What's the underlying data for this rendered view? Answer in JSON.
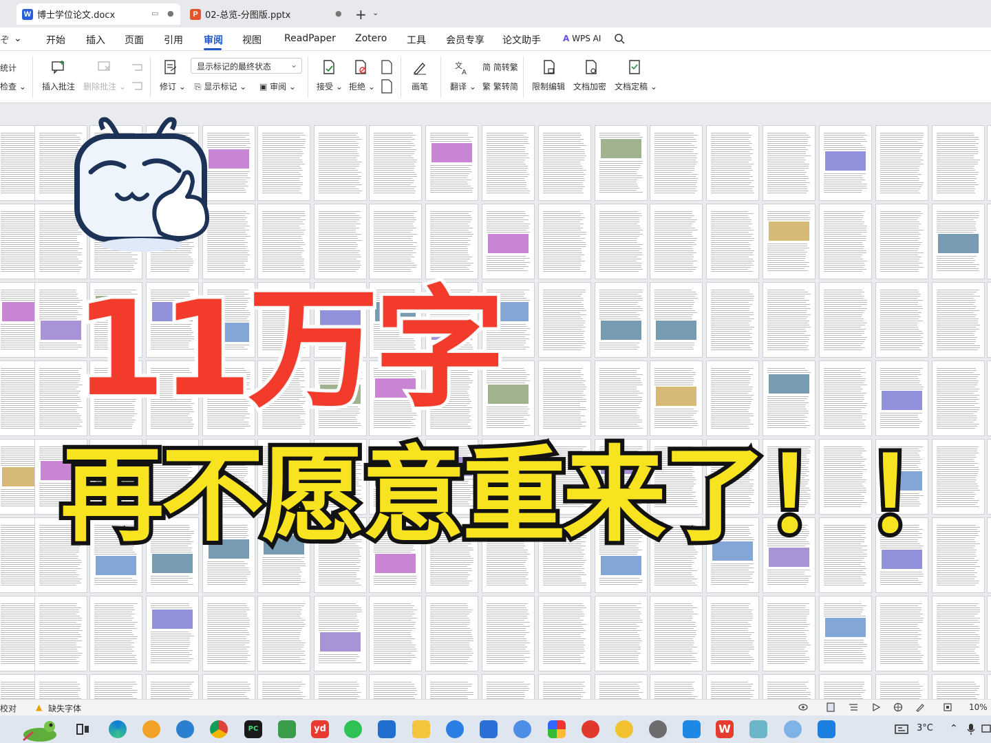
{
  "tabs": [
    {
      "label": "博士学位论文.docx",
      "app": "W",
      "color": "#2b5fd9"
    },
    {
      "label": "02-总览-分图版.pptx",
      "app": "P",
      "color": "#e2552c"
    }
  ],
  "menu": {
    "items": [
      "开始",
      "插入",
      "页面",
      "引用",
      "审阅",
      "视图",
      "ReadPaper",
      "Zotero",
      "工具",
      "会员专享",
      "论文助手",
      "WPS AI"
    ],
    "active": "审阅"
  },
  "ribbon": {
    "stats": "统计",
    "check": "检查",
    "insert_comment": "插入批注",
    "delete_comment": "删除批注",
    "markup_state": "显示标记的最终状态",
    "revise": "修订",
    "show_markup": "显示标记",
    "review": "审阅",
    "accept": "接受",
    "reject": "拒绝",
    "pen": "画笔",
    "translate": "翻译",
    "to_traditional": "简转繁",
    "to_simplified": "繁转简",
    "restrict_edit": "限制编辑",
    "doc_encrypt": "文档加密",
    "doc_finalize": "文档定稿"
  },
  "overlay": {
    "headline": "11万字",
    "subline": "再不愿意重来了！！"
  },
  "statusbar": {
    "proofread": "校对",
    "missing_font": "缺失字体",
    "zoom": "10%"
  },
  "taskbar": {
    "temperature": "3°C"
  },
  "colors": {
    "accent": "#1f58c9",
    "headline_red": "#f23b2b",
    "subline_yellow": "#f8e321"
  }
}
